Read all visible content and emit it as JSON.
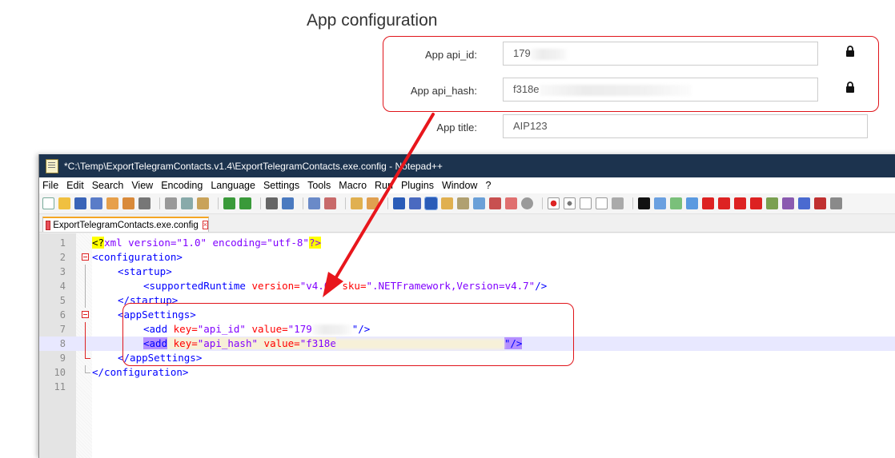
{
  "form": {
    "title": "App configuration",
    "api_id": {
      "label": "App api_id:",
      "value": "179"
    },
    "api_hash": {
      "label": "App api_hash:",
      "value": "f318e"
    },
    "app_title": {
      "label": "App title:",
      "value": "AIP123"
    },
    "lock_icon": "lock-icon"
  },
  "notepad": {
    "title": "*C:\\Temp\\ExportTelegramContacts.v1.4\\ExportTelegramContacts.exe.config - Notepad++",
    "menu": [
      "File",
      "Edit",
      "Search",
      "View",
      "Encoding",
      "Language",
      "Settings",
      "Tools",
      "Macro",
      "Run",
      "Plugins",
      "Window",
      "?"
    ],
    "tab_label": "ExportTelegramContacts.exe.config",
    "lines": {
      "l1": {
        "num": "1",
        "pre": "<?",
        "a": "xml version=\"1.0\" encoding=\"utf-8\"",
        "post": "?>"
      },
      "l2": {
        "num": "2",
        "text": "<configuration>"
      },
      "l3": {
        "num": "3",
        "text": "<startup>"
      },
      "l4": {
        "num": "4",
        "tag": "<supportedRuntime ",
        "a1": "version=",
        "v1": "\"v4.0\" ",
        "a2": "sku=",
        "v2": "\".NETFramework,Version=v4.7\"",
        "end": "/>"
      },
      "l5": {
        "num": "5",
        "text": "</startup>"
      },
      "l6": {
        "num": "6",
        "text": "<appSettings>"
      },
      "l7": {
        "num": "7",
        "tag": "<add ",
        "a1": "key=",
        "v1": "\"api_id\" ",
        "a2": "value=",
        "v2": "\"179",
        "end": "\"/>"
      },
      "l8": {
        "num": "8",
        "tag": "<add",
        "a1": "key=",
        "v1": "\"api_hash\"",
        "a2": "value=",
        "v2": "\"f318e",
        "end": "\"/>"
      },
      "l9": {
        "num": "9",
        "text": "</appSettings>"
      },
      "l10": {
        "num": "10",
        "text": "</configuration>"
      },
      "l11": {
        "num": "11",
        "text": ""
      }
    }
  },
  "colors": {
    "annotation_red": "#e0141a",
    "titlebar": "#1c334e"
  }
}
